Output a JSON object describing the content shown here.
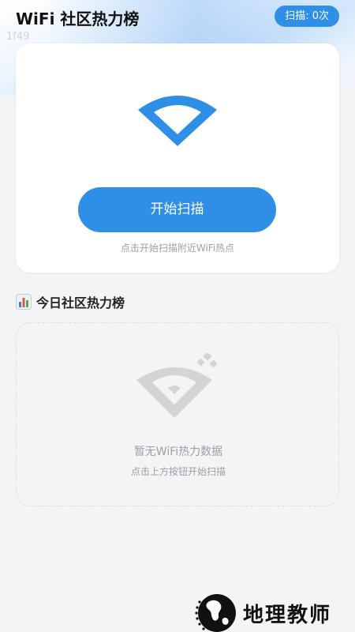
{
  "header": {
    "title": "WiFi 社区热力榜",
    "scan_count": "扫描: 0次",
    "faint_id": "1f49"
  },
  "scan_card": {
    "icon": "wifi-icon",
    "button_label": "开始扫描",
    "hint": "点击开始扫描附近WiFi热点"
  },
  "ranking": {
    "icon": "bar-chart-icon",
    "title": "今日社区热力榜",
    "empty_icon": "wifi-off-icon",
    "empty_title": "暂无WiFi热力数据",
    "empty_subtitle": "点击上方按钮开始扫描"
  },
  "watermark": {
    "text": "地理教师"
  },
  "colors": {
    "accent": "#2f8fe6",
    "background": "#f3f4f6",
    "muted_text": "#9aa0a6",
    "icon_gray": "#d4d4d4"
  }
}
